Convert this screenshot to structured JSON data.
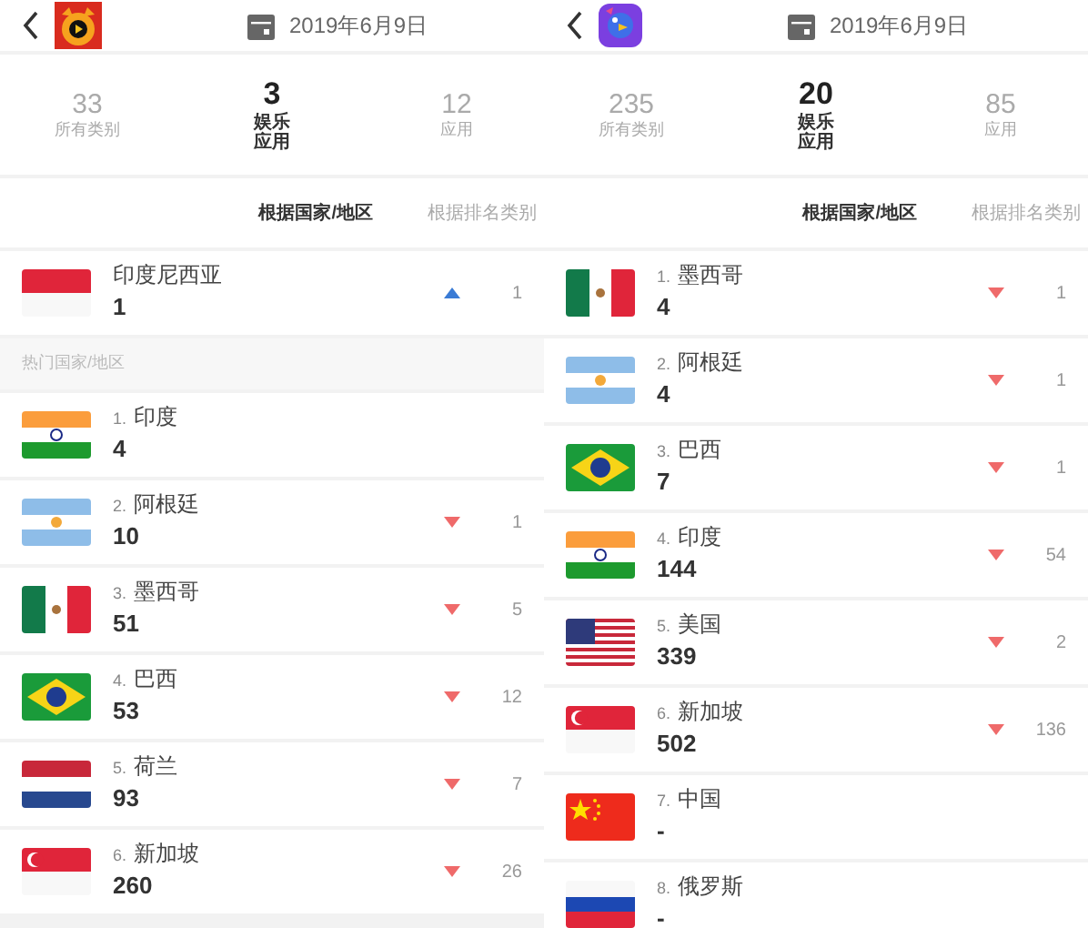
{
  "panels": [
    {
      "app_icon": {
        "kind": "cat"
      },
      "date": "2019年6月9日",
      "stats": [
        {
          "value": "33",
          "label": "所有类别",
          "selected": false
        },
        {
          "value": "3",
          "label": "娱乐应用",
          "selected": true
        },
        {
          "value": "12",
          "label": "应用",
          "selected": false
        }
      ],
      "tabs": [
        {
          "label": "根据国家/地区",
          "selected": true
        },
        {
          "label": "根据排名类别",
          "selected": false
        }
      ],
      "highlight": {
        "kind": "id",
        "name": "印度尼西亚",
        "value": "1",
        "rising": true,
        "falling": false,
        "change": "1"
      },
      "section_label": "热门国家/地区",
      "rows": [
        {
          "kind": "in",
          "rank": "1.",
          "name": "印度",
          "value": "4",
          "rising": false,
          "falling": false
        },
        {
          "kind": "ar",
          "rank": "2.",
          "name": "阿根廷",
          "value": "10",
          "rising": false,
          "falling": true,
          "change": "1"
        },
        {
          "kind": "mx",
          "rank": "3.",
          "name": "墨西哥",
          "value": "51",
          "rising": false,
          "falling": true,
          "change": "5"
        },
        {
          "kind": "br",
          "rank": "4.",
          "name": "巴西",
          "value": "53",
          "rising": false,
          "falling": true,
          "change": "12"
        },
        {
          "kind": "nl",
          "rank": "5.",
          "name": "荷兰",
          "value": "93",
          "rising": false,
          "falling": true,
          "change": "7"
        },
        {
          "kind": "sg",
          "rank": "6.",
          "name": "新加坡",
          "value": "260",
          "rising": false,
          "falling": true,
          "change": "26"
        }
      ]
    },
    {
      "app_icon": {
        "kind": "bird"
      },
      "date": "2019年6月9日",
      "stats": [
        {
          "value": "235",
          "label": "所有类别",
          "selected": false
        },
        {
          "value": "20",
          "label": "娱乐应用",
          "selected": true
        },
        {
          "value": "85",
          "label": "应用",
          "selected": false
        }
      ],
      "tabs": [
        {
          "label": "根据国家/地区",
          "selected": true
        },
        {
          "label": "根据排名类别",
          "selected": false
        }
      ],
      "rows": [
        {
          "kind": "mx",
          "rank": "1.",
          "name": "墨西哥",
          "value": "4",
          "rising": false,
          "falling": true,
          "change": "1"
        },
        {
          "kind": "ar",
          "rank": "2.",
          "name": "阿根廷",
          "value": "4",
          "rising": false,
          "falling": true,
          "change": "1"
        },
        {
          "kind": "br",
          "rank": "3.",
          "name": "巴西",
          "value": "7",
          "rising": false,
          "falling": true,
          "change": "1"
        },
        {
          "kind": "in",
          "rank": "4.",
          "name": "印度",
          "value": "144",
          "rising": false,
          "falling": true,
          "change": "54"
        },
        {
          "kind": "us",
          "rank": "5.",
          "name": "美国",
          "value": "339",
          "rising": false,
          "falling": true,
          "change": "2"
        },
        {
          "kind": "sg",
          "rank": "6.",
          "name": "新加坡",
          "value": "502",
          "rising": false,
          "falling": true,
          "change": "136"
        },
        {
          "kind": "cn",
          "rank": "7.",
          "name": "中国",
          "value": "-",
          "rising": false,
          "falling": false
        },
        {
          "kind": "ru",
          "rank": "8.",
          "name": "俄罗斯",
          "value": "-",
          "rising": false,
          "falling": false
        }
      ]
    }
  ]
}
